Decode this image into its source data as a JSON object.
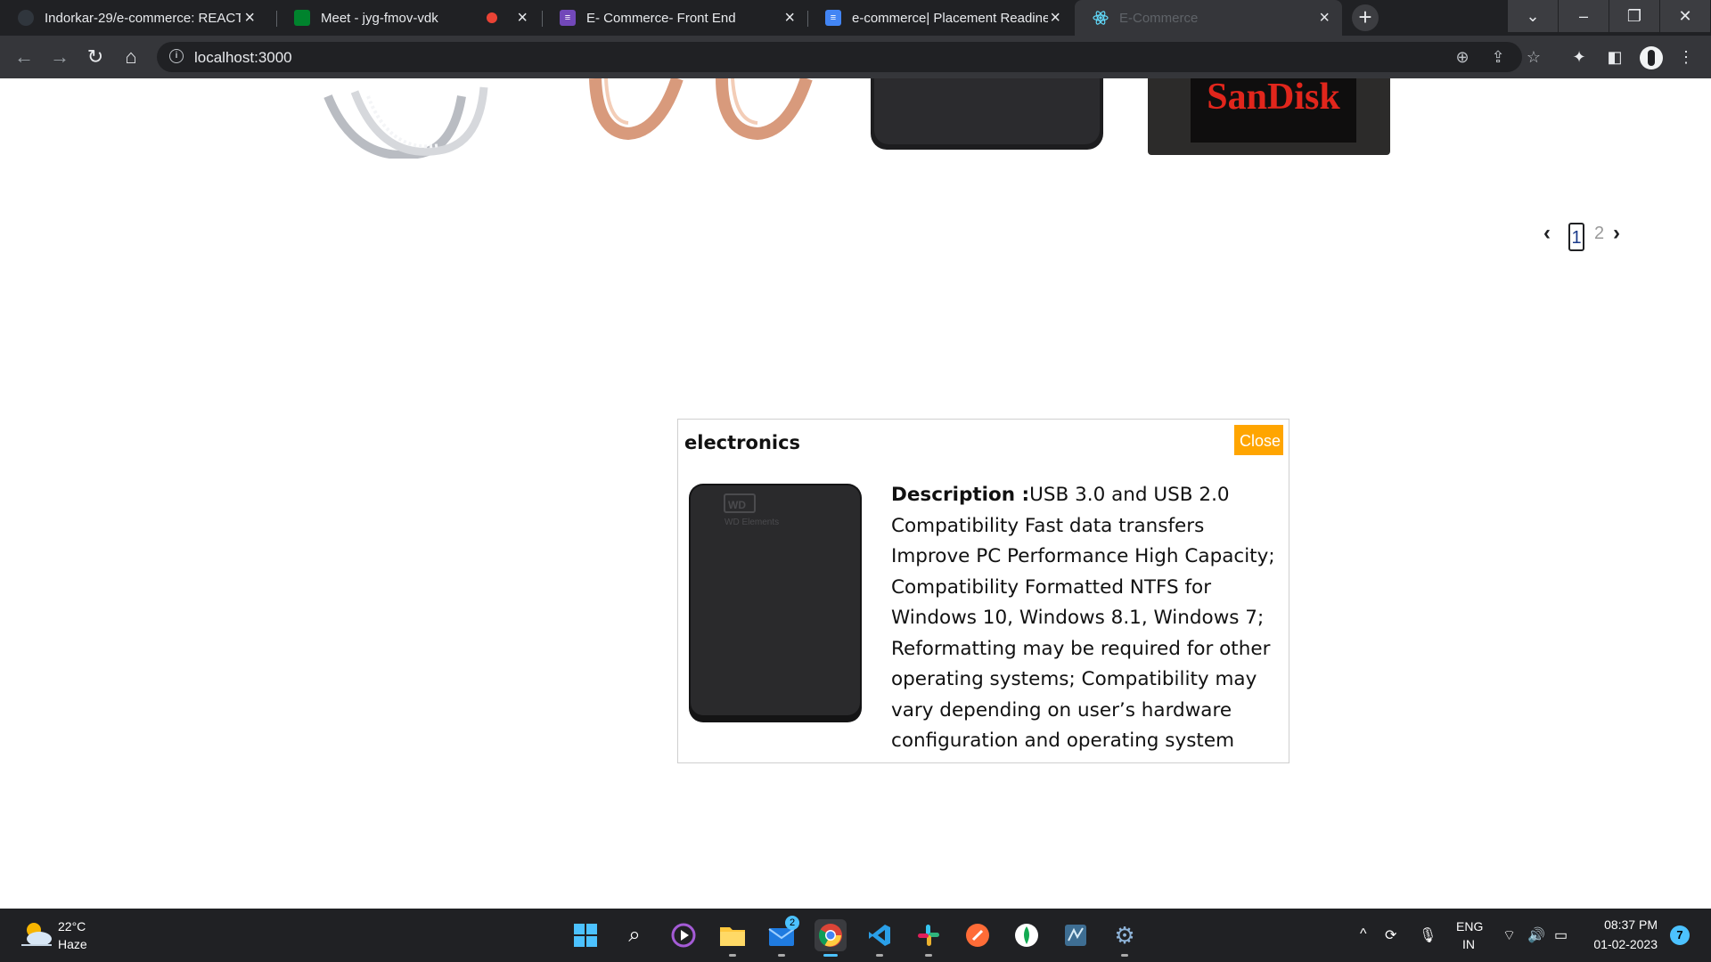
{
  "browser": {
    "tabs": [
      {
        "title": "Indorkar-29/e-commerce: REACT",
        "icon": "github-icon"
      },
      {
        "title": "Meet - jyg-fmov-vdk",
        "icon": "google-meet-icon"
      },
      {
        "title": "E- Commerce- Front End",
        "icon": "google-forms-icon"
      },
      {
        "title": "e-commerce| Placement Readine",
        "icon": "google-docs-icon"
      },
      {
        "title": "E-Commerce",
        "icon": "react-icon",
        "active": true
      }
    ],
    "url": "localhost:3000"
  },
  "page": {
    "products": [
      {
        "name": "ring",
        "icon": "ring-image"
      },
      {
        "name": "earrings",
        "icon": "earrings-image"
      },
      {
        "name": "hard-drive",
        "icon": "hard-drive-image"
      },
      {
        "name": "sandisk",
        "label": "SanDisk",
        "icon": "ssd-image"
      }
    ],
    "pagination": {
      "prev": "‹",
      "pages": [
        "1",
        "2"
      ],
      "current": "1",
      "next": "›"
    }
  },
  "modal": {
    "category": "electronics",
    "close_label": "Close",
    "description_label": "Description :",
    "description_text": "USB 3.0 and USB 2.0 Compatibility Fast data transfers Improve PC Performance High Capacity; Compatibility Formatted NTFS for Windows 10, Windows 8.1, Windows 7; Reformatting may be required for other operating systems; Compatibility may vary depending on user’s hardware configuration and operating system",
    "image_label": "WD Elements"
  },
  "taskbar": {
    "weather_temp": "22°C",
    "weather_condition": "Haze",
    "mail_badge": "2",
    "lang_line1": "ENG",
    "lang_line2": "IN",
    "time": "08:37 PM",
    "date": "01-02-2023",
    "notification_count": "7"
  },
  "colors": {
    "close_button": "#ffa500",
    "tab_bar": "#202124",
    "toolbar": "#35363a",
    "sandisk_red": "#e1261c"
  }
}
